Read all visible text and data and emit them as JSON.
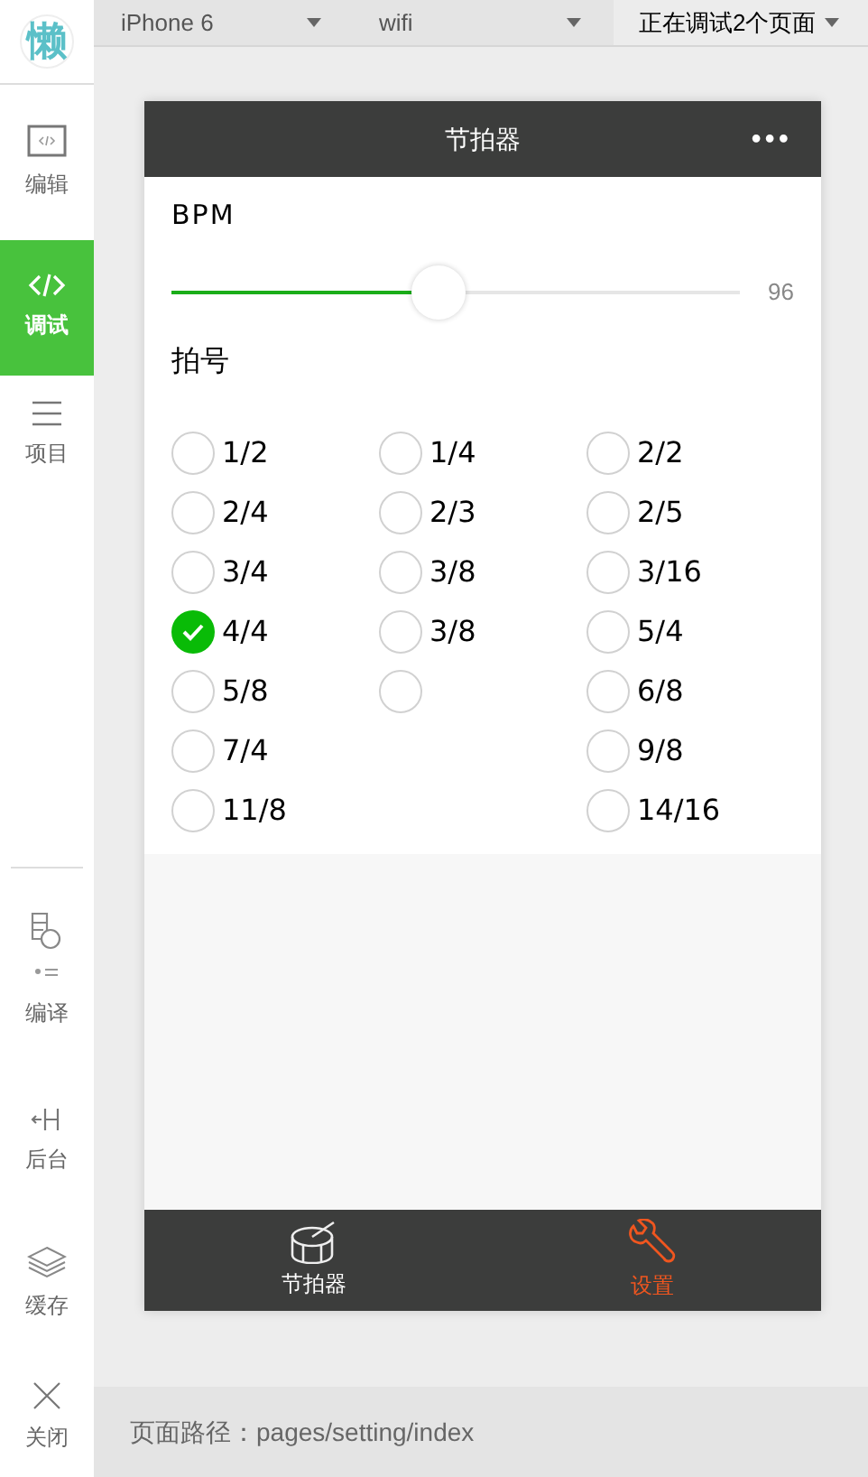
{
  "sidebar": {
    "logo": "懒",
    "items": [
      {
        "kind": "edit",
        "label": "编辑",
        "selected": false
      },
      {
        "kind": "debug",
        "label": "调试",
        "selected": true
      },
      {
        "kind": "project",
        "label": "项目",
        "selected": false
      },
      {
        "kind": "compile",
        "label": "编译",
        "selected": false
      },
      {
        "kind": "backend",
        "label": "后台",
        "selected": false
      },
      {
        "kind": "cache",
        "label": "缓存",
        "selected": false
      },
      {
        "kind": "close",
        "label": "关闭",
        "selected": false
      }
    ]
  },
  "toolbar": {
    "device": "iPhone 6",
    "network": "wifi",
    "pages": "正在调试2个页面"
  },
  "phone": {
    "title": "节拍器",
    "menu": "•••",
    "bpm_label": "BPM",
    "bpm": {
      "level": 0.47,
      "reading": "96"
    },
    "beat_label": "拍号",
    "columns": [
      [
        {
          "label": "1/2",
          "selected": false
        },
        {
          "label": "2/4",
          "selected": false
        },
        {
          "label": "3/4",
          "selected": false
        },
        {
          "label": "4/4",
          "selected": true
        },
        {
          "label": "5/8",
          "selected": false
        },
        {
          "label": "7/4",
          "selected": false
        },
        {
          "label": "11/8",
          "selected": false
        }
      ],
      [
        {
          "label": "1/4",
          "selected": false
        },
        {
          "label": "2/3",
          "selected": false
        },
        {
          "label": "3/8",
          "selected": false
        },
        {
          "label": "3/8",
          "selected": false
        },
        {
          "selected": false
        }
      ],
      [
        {
          "label": "2/2",
          "selected": false
        },
        {
          "label": "2/5",
          "selected": false
        },
        {
          "label": "3/16",
          "selected": false
        },
        {
          "label": "5/4",
          "selected": false
        },
        {
          "label": "6/8",
          "selected": false
        },
        {
          "label": "9/8",
          "selected": false
        },
        {
          "label": "14/16",
          "selected": false
        }
      ]
    ],
    "tabs": [
      {
        "kind": "drum",
        "label": "节拍器",
        "selected": false
      },
      {
        "kind": "wrench",
        "label": "设置",
        "selected": true
      }
    ]
  },
  "footer": {
    "path": "页面路径：pages/setting/index"
  }
}
